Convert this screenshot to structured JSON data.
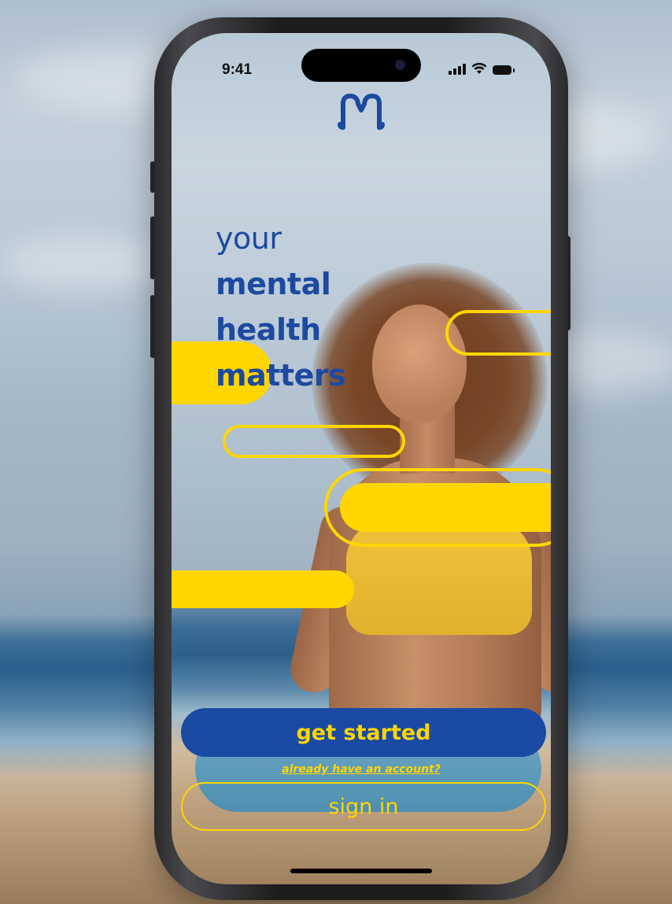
{
  "status_bar": {
    "time": "9:41",
    "signal_icon": "cellular-signal-icon",
    "wifi_icon": "wifi-icon",
    "battery_icon": "battery-icon"
  },
  "brand": {
    "logo_icon": "m-logo-icon",
    "primary_color": "#1a4aa3",
    "accent_color": "#ffd600"
  },
  "headline": {
    "line1": "your",
    "line2": "mental",
    "line3": "health",
    "line4": "matters"
  },
  "actions": {
    "get_started_label": "get started",
    "account_prompt": "already have an account?",
    "sign_in_label": "sign in"
  }
}
